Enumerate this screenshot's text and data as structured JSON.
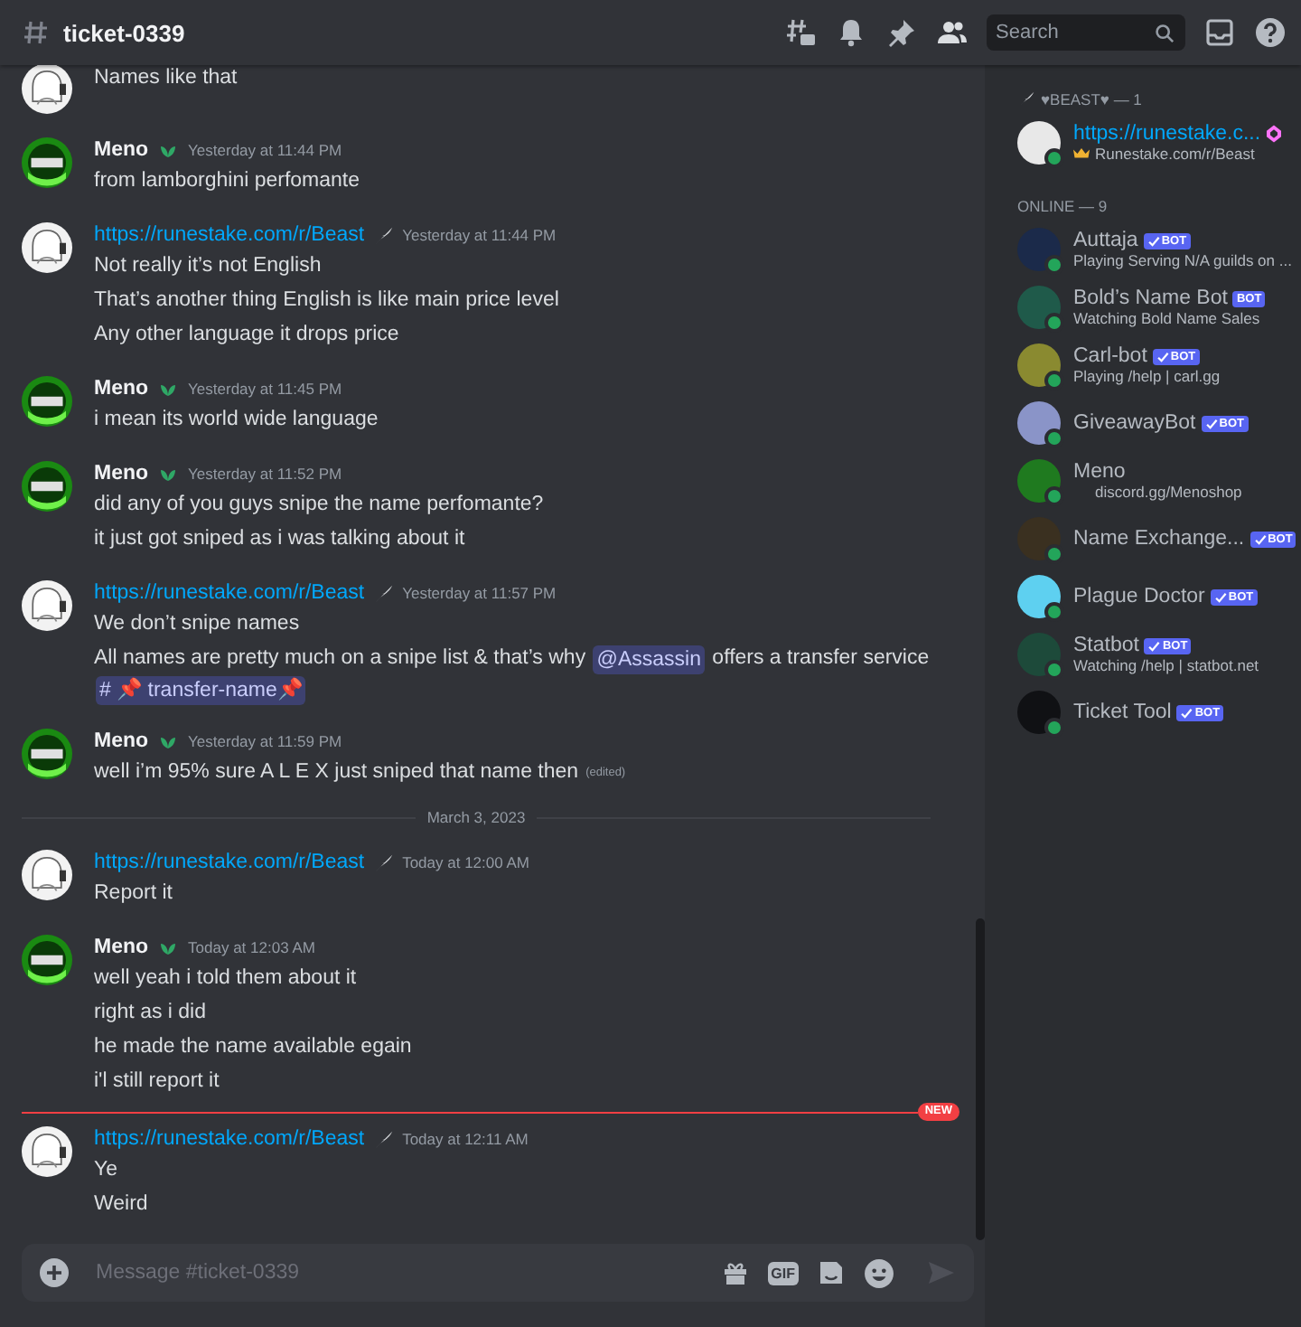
{
  "channel": {
    "name": "ticket-0339"
  },
  "search": {
    "placeholder": "Search"
  },
  "messages": [
    {
      "kind": "group",
      "author": {
        "kind": "link"
      },
      "lines": [
        "Names like that"
      ]
    },
    {
      "kind": "group",
      "author": {
        "kind": "user",
        "name": "Meno"
      },
      "timestamp": "Yesterday at 11:44 PM",
      "lines": [
        "from lamborghini perfomante"
      ]
    },
    {
      "kind": "group",
      "author": {
        "kind": "link",
        "name": "https://runestake.com/r/Beast"
      },
      "timestamp": "Yesterday at 11:44 PM",
      "lines": [
        "Not really it’s not English",
        "That’s another thing English is like main price level",
        "Any other language it drops price"
      ]
    },
    {
      "kind": "group",
      "author": {
        "kind": "user",
        "name": "Meno"
      },
      "timestamp": "Yesterday at 11:45 PM",
      "lines": [
        "i mean its world wide language"
      ]
    },
    {
      "kind": "group",
      "author": {
        "kind": "user",
        "name": "Meno"
      },
      "timestamp": "Yesterday at 11:52 PM",
      "lines": [
        "did any of you guys snipe the name perfomante?",
        "it just got sniped as i was talking about it"
      ]
    },
    {
      "kind": "group",
      "author": {
        "kind": "link",
        "name": "https://runestake.com/r/Beast"
      },
      "timestamp": "Yesterday at 11:57 PM",
      "lines": [
        "We don’t snipe names",
        [
          {
            "kind": "text",
            "text": "All names are pretty much on a snipe list & that’s why "
          },
          {
            "kind": "mention",
            "text": "@Assassin"
          },
          {
            "kind": "text",
            "text": " offers a transfer service"
          }
        ],
        [
          {
            "kind": "channel",
            "text": "# 📌 transfer-name📌"
          }
        ]
      ]
    },
    {
      "kind": "group",
      "author": {
        "kind": "user",
        "name": "Meno"
      },
      "timestamp": "Yesterday at 11:59 PM",
      "lines": [
        [
          {
            "kind": "text",
            "text": "well i’m 95% sure A L E X just sniped that name then"
          },
          {
            "kind": "edited",
            "text": "(edited)"
          }
        ]
      ]
    },
    {
      "kind": "date_divider",
      "text": "March 3, 2023"
    },
    {
      "kind": "group",
      "author": {
        "kind": "link",
        "name": "https://runestake.com/r/Beast"
      },
      "timestamp": "Today at 12:00 AM",
      "lines": [
        "Report it"
      ]
    },
    {
      "kind": "group",
      "author": {
        "kind": "user",
        "name": "Meno"
      },
      "timestamp": "Today at 12:03 AM",
      "lines": [
        "well yeah i told them about it",
        "right as i did",
        "he made the name available egain",
        "i'l still report it"
      ]
    },
    {
      "kind": "new_divider",
      "text": "NEW"
    },
    {
      "kind": "group",
      "author": {
        "kind": "link",
        "name": "https://runestake.com/r/Beast"
      },
      "timestamp": "Today at 12:11 AM",
      "lines": [
        "Ye",
        "Weird"
      ]
    }
  ],
  "composer": {
    "placeholder": "Message #ticket-0339",
    "gif_label": "GIF"
  },
  "member_groups": [
    {
      "title": "♥BEAST♥ — 1",
      "role_icon": true,
      "members": [
        {
          "name": "https://runestake.c...",
          "kind": "link",
          "status": {
            "kind": "crown",
            "text": "Runestake.com/r/Beast"
          },
          "color": "#e8e8e8",
          "boost": true
        }
      ]
    },
    {
      "title": "ONLINE — 9",
      "role_icon": false,
      "members": [
        {
          "name": "Auttaja",
          "kind": "plain",
          "status": {
            "kind": "plain",
            "text": "Playing Serving N/A guilds on ..."
          },
          "color": "#1b2a4a",
          "tag": "BOT",
          "verified": true,
          "boost": false
        },
        {
          "name": "Bold’s Name Bot",
          "kind": "plain",
          "status": {
            "kind": "plain",
            "text": "Watching Bold Name Sales"
          },
          "color": "#1f5a4a",
          "tag": "BOT",
          "verified": false,
          "boost": false
        },
        {
          "name": "Carl-bot",
          "kind": "plain",
          "status": {
            "kind": "plain",
            "text": "Playing /help | carl.gg"
          },
          "color": "#8a8a30",
          "tag": "BOT",
          "verified": true,
          "boost": false
        },
        {
          "name": "GiveawayBot",
          "kind": "plain",
          "color": "#8a94c8",
          "tag": "BOT",
          "verified": true,
          "boost": false
        },
        {
          "name": "Meno",
          "kind": "plain",
          "status": {
            "kind": "indented",
            "text": "discord.gg/Menoshop"
          },
          "color": "#1f7a1f",
          "boost": false
        },
        {
          "name": "Name Exchange...",
          "kind": "plain",
          "color": "#3a3020",
          "tag": "BOT",
          "verified": true,
          "boost": false
        },
        {
          "name": "Plague Doctor",
          "kind": "plain",
          "color": "#5ed0f0",
          "tag": "BOT",
          "verified": true,
          "boost": false
        },
        {
          "name": "Statbot",
          "kind": "plain",
          "status": {
            "kind": "plain",
            "text": "Watching /help | statbot.net"
          },
          "color": "#1d4a3a",
          "tag": "BOT",
          "verified": true,
          "boost": false
        },
        {
          "name": "Ticket Tool",
          "kind": "plain",
          "color": "#101114",
          "tag": "BOT",
          "verified": true,
          "boost": false
        }
      ]
    }
  ]
}
